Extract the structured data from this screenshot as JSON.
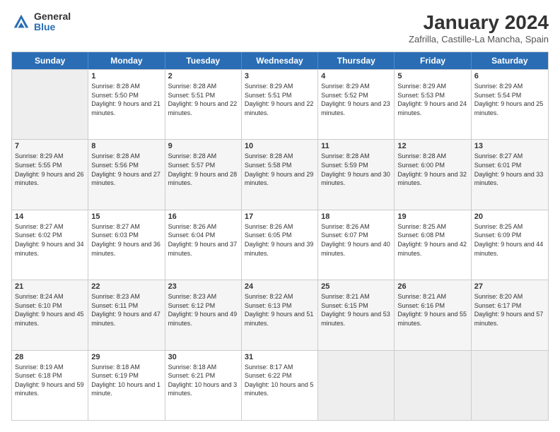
{
  "logo": {
    "general": "General",
    "blue": "Blue"
  },
  "title": "January 2024",
  "location": "Zafrilla, Castille-La Mancha, Spain",
  "weekdays": [
    "Sunday",
    "Monday",
    "Tuesday",
    "Wednesday",
    "Thursday",
    "Friday",
    "Saturday"
  ],
  "weeks": [
    [
      {
        "day": "",
        "sunrise": "",
        "sunset": "",
        "daylight": ""
      },
      {
        "day": "1",
        "sunrise": "Sunrise: 8:28 AM",
        "sunset": "Sunset: 5:50 PM",
        "daylight": "Daylight: 9 hours and 21 minutes."
      },
      {
        "day": "2",
        "sunrise": "Sunrise: 8:28 AM",
        "sunset": "Sunset: 5:51 PM",
        "daylight": "Daylight: 9 hours and 22 minutes."
      },
      {
        "day": "3",
        "sunrise": "Sunrise: 8:29 AM",
        "sunset": "Sunset: 5:51 PM",
        "daylight": "Daylight: 9 hours and 22 minutes."
      },
      {
        "day": "4",
        "sunrise": "Sunrise: 8:29 AM",
        "sunset": "Sunset: 5:52 PM",
        "daylight": "Daylight: 9 hours and 23 minutes."
      },
      {
        "day": "5",
        "sunrise": "Sunrise: 8:29 AM",
        "sunset": "Sunset: 5:53 PM",
        "daylight": "Daylight: 9 hours and 24 minutes."
      },
      {
        "day": "6",
        "sunrise": "Sunrise: 8:29 AM",
        "sunset": "Sunset: 5:54 PM",
        "daylight": "Daylight: 9 hours and 25 minutes."
      }
    ],
    [
      {
        "day": "7",
        "sunrise": "Sunrise: 8:29 AM",
        "sunset": "Sunset: 5:55 PM",
        "daylight": "Daylight: 9 hours and 26 minutes."
      },
      {
        "day": "8",
        "sunrise": "Sunrise: 8:28 AM",
        "sunset": "Sunset: 5:56 PM",
        "daylight": "Daylight: 9 hours and 27 minutes."
      },
      {
        "day": "9",
        "sunrise": "Sunrise: 8:28 AM",
        "sunset": "Sunset: 5:57 PM",
        "daylight": "Daylight: 9 hours and 28 minutes."
      },
      {
        "day": "10",
        "sunrise": "Sunrise: 8:28 AM",
        "sunset": "Sunset: 5:58 PM",
        "daylight": "Daylight: 9 hours and 29 minutes."
      },
      {
        "day": "11",
        "sunrise": "Sunrise: 8:28 AM",
        "sunset": "Sunset: 5:59 PM",
        "daylight": "Daylight: 9 hours and 30 minutes."
      },
      {
        "day": "12",
        "sunrise": "Sunrise: 8:28 AM",
        "sunset": "Sunset: 6:00 PM",
        "daylight": "Daylight: 9 hours and 32 minutes."
      },
      {
        "day": "13",
        "sunrise": "Sunrise: 8:27 AM",
        "sunset": "Sunset: 6:01 PM",
        "daylight": "Daylight: 9 hours and 33 minutes."
      }
    ],
    [
      {
        "day": "14",
        "sunrise": "Sunrise: 8:27 AM",
        "sunset": "Sunset: 6:02 PM",
        "daylight": "Daylight: 9 hours and 34 minutes."
      },
      {
        "day": "15",
        "sunrise": "Sunrise: 8:27 AM",
        "sunset": "Sunset: 6:03 PM",
        "daylight": "Daylight: 9 hours and 36 minutes."
      },
      {
        "day": "16",
        "sunrise": "Sunrise: 8:26 AM",
        "sunset": "Sunset: 6:04 PM",
        "daylight": "Daylight: 9 hours and 37 minutes."
      },
      {
        "day": "17",
        "sunrise": "Sunrise: 8:26 AM",
        "sunset": "Sunset: 6:05 PM",
        "daylight": "Daylight: 9 hours and 39 minutes."
      },
      {
        "day": "18",
        "sunrise": "Sunrise: 8:26 AM",
        "sunset": "Sunset: 6:07 PM",
        "daylight": "Daylight: 9 hours and 40 minutes."
      },
      {
        "day": "19",
        "sunrise": "Sunrise: 8:25 AM",
        "sunset": "Sunset: 6:08 PM",
        "daylight": "Daylight: 9 hours and 42 minutes."
      },
      {
        "day": "20",
        "sunrise": "Sunrise: 8:25 AM",
        "sunset": "Sunset: 6:09 PM",
        "daylight": "Daylight: 9 hours and 44 minutes."
      }
    ],
    [
      {
        "day": "21",
        "sunrise": "Sunrise: 8:24 AM",
        "sunset": "Sunset: 6:10 PM",
        "daylight": "Daylight: 9 hours and 45 minutes."
      },
      {
        "day": "22",
        "sunrise": "Sunrise: 8:23 AM",
        "sunset": "Sunset: 6:11 PM",
        "daylight": "Daylight: 9 hours and 47 minutes."
      },
      {
        "day": "23",
        "sunrise": "Sunrise: 8:23 AM",
        "sunset": "Sunset: 6:12 PM",
        "daylight": "Daylight: 9 hours and 49 minutes."
      },
      {
        "day": "24",
        "sunrise": "Sunrise: 8:22 AM",
        "sunset": "Sunset: 6:13 PM",
        "daylight": "Daylight: 9 hours and 51 minutes."
      },
      {
        "day": "25",
        "sunrise": "Sunrise: 8:21 AM",
        "sunset": "Sunset: 6:15 PM",
        "daylight": "Daylight: 9 hours and 53 minutes."
      },
      {
        "day": "26",
        "sunrise": "Sunrise: 8:21 AM",
        "sunset": "Sunset: 6:16 PM",
        "daylight": "Daylight: 9 hours and 55 minutes."
      },
      {
        "day": "27",
        "sunrise": "Sunrise: 8:20 AM",
        "sunset": "Sunset: 6:17 PM",
        "daylight": "Daylight: 9 hours and 57 minutes."
      }
    ],
    [
      {
        "day": "28",
        "sunrise": "Sunrise: 8:19 AM",
        "sunset": "Sunset: 6:18 PM",
        "daylight": "Daylight: 9 hours and 59 minutes."
      },
      {
        "day": "29",
        "sunrise": "Sunrise: 8:18 AM",
        "sunset": "Sunset: 6:19 PM",
        "daylight": "Daylight: 10 hours and 1 minute."
      },
      {
        "day": "30",
        "sunrise": "Sunrise: 8:18 AM",
        "sunset": "Sunset: 6:21 PM",
        "daylight": "Daylight: 10 hours and 3 minutes."
      },
      {
        "day": "31",
        "sunrise": "Sunrise: 8:17 AM",
        "sunset": "Sunset: 6:22 PM",
        "daylight": "Daylight: 10 hours and 5 minutes."
      },
      {
        "day": "",
        "sunrise": "",
        "sunset": "",
        "daylight": ""
      },
      {
        "day": "",
        "sunrise": "",
        "sunset": "",
        "daylight": ""
      },
      {
        "day": "",
        "sunrise": "",
        "sunset": "",
        "daylight": ""
      }
    ]
  ]
}
